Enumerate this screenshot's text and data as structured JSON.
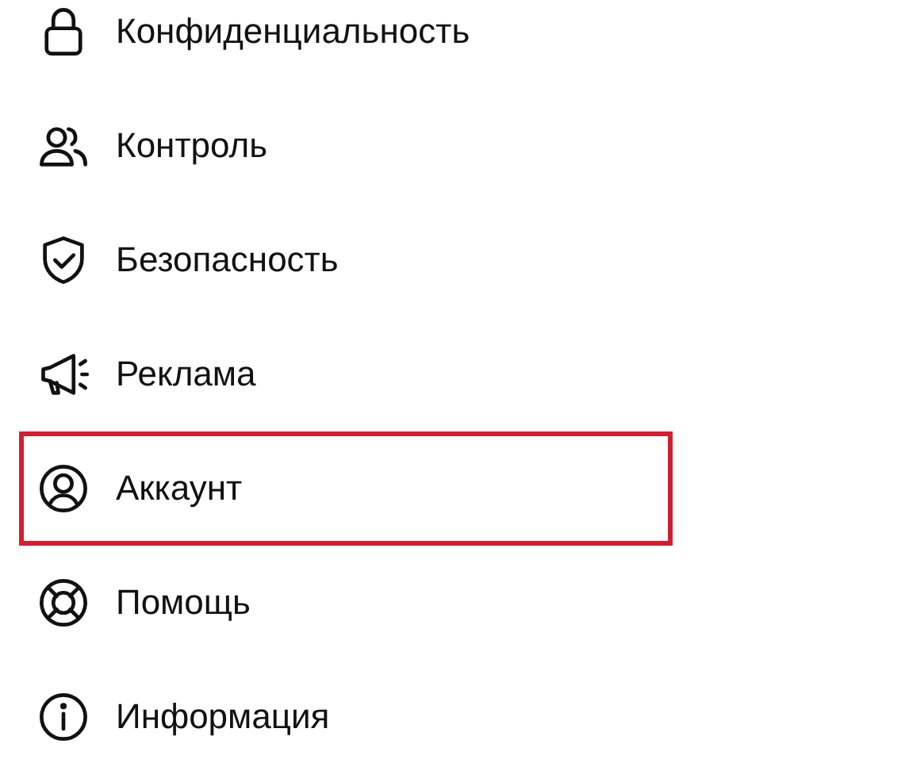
{
  "menu": [
    {
      "kind": "lock",
      "label": "Конфиденциальность",
      "highlighted": false
    },
    {
      "kind": "people",
      "label": "Контроль",
      "highlighted": false
    },
    {
      "kind": "shield",
      "label": "Безопасность",
      "highlighted": false
    },
    {
      "kind": "megaphone",
      "label": "Реклама",
      "highlighted": false
    },
    {
      "kind": "account",
      "label": "Аккаунт",
      "highlighted": true
    },
    {
      "kind": "help",
      "label": "Помощь",
      "highlighted": false
    },
    {
      "kind": "info",
      "label": "Информация",
      "highlighted": false
    }
  ]
}
